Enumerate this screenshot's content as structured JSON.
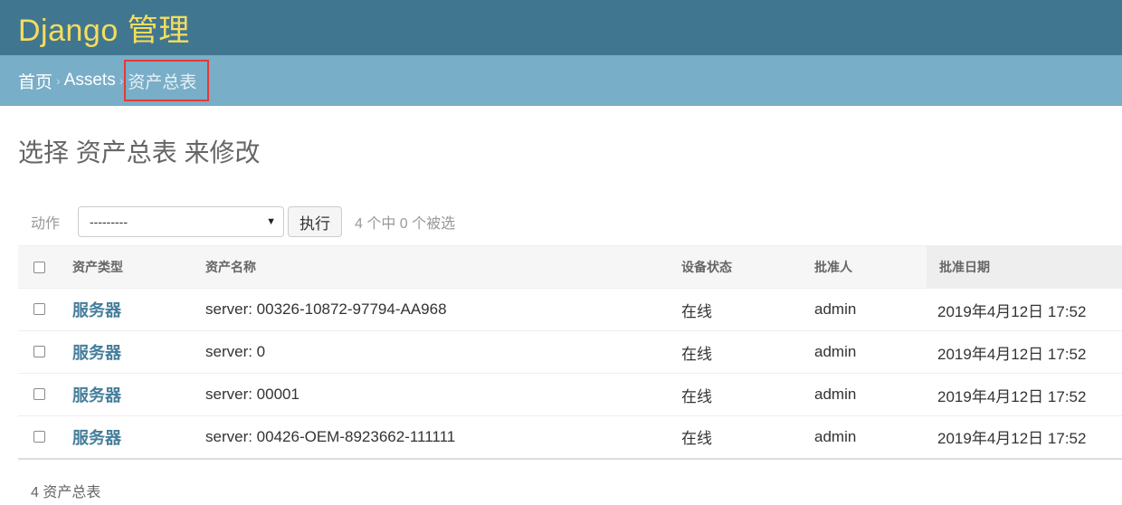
{
  "header": {
    "branding": "Django 管理"
  },
  "breadcrumbs": {
    "home": "首页",
    "separator": "›",
    "app": "Assets",
    "current": "资产总表"
  },
  "page": {
    "title": "选择 资产总表 来修改"
  },
  "actions": {
    "label": "动作",
    "select_value": "---------",
    "go_label": "执行",
    "counter": "4 个中 0 个被选"
  },
  "table": {
    "headers": {
      "type": "资产类型",
      "name": "资产名称",
      "status": "设备状态",
      "approver": "批准人",
      "date": "批准日期"
    },
    "rows": [
      {
        "type": "服务器",
        "name": "server: 00326-10872-97794-AA968",
        "status": "在线",
        "approver": "admin",
        "date": "2019年4月12日 17:52"
      },
      {
        "type": "服务器",
        "name": "server: 0",
        "status": "在线",
        "approver": "admin",
        "date": "2019年4月12日 17:52"
      },
      {
        "type": "服务器",
        "name": "server: 00001",
        "status": "在线",
        "approver": "admin",
        "date": "2019年4月12日 17:52"
      },
      {
        "type": "服务器",
        "name": "server: 00426-OEM-8923662-111111",
        "status": "在线",
        "approver": "admin",
        "date": "2019年4月12日 17:52"
      }
    ]
  },
  "paginator": {
    "text": "4 资产总表"
  },
  "colors": {
    "header_bg": "#417690",
    "branding": "#f5dd5d",
    "breadcrumbs_bg": "#79aec8",
    "link": "#447e9b",
    "highlight_border": "#e53935"
  }
}
